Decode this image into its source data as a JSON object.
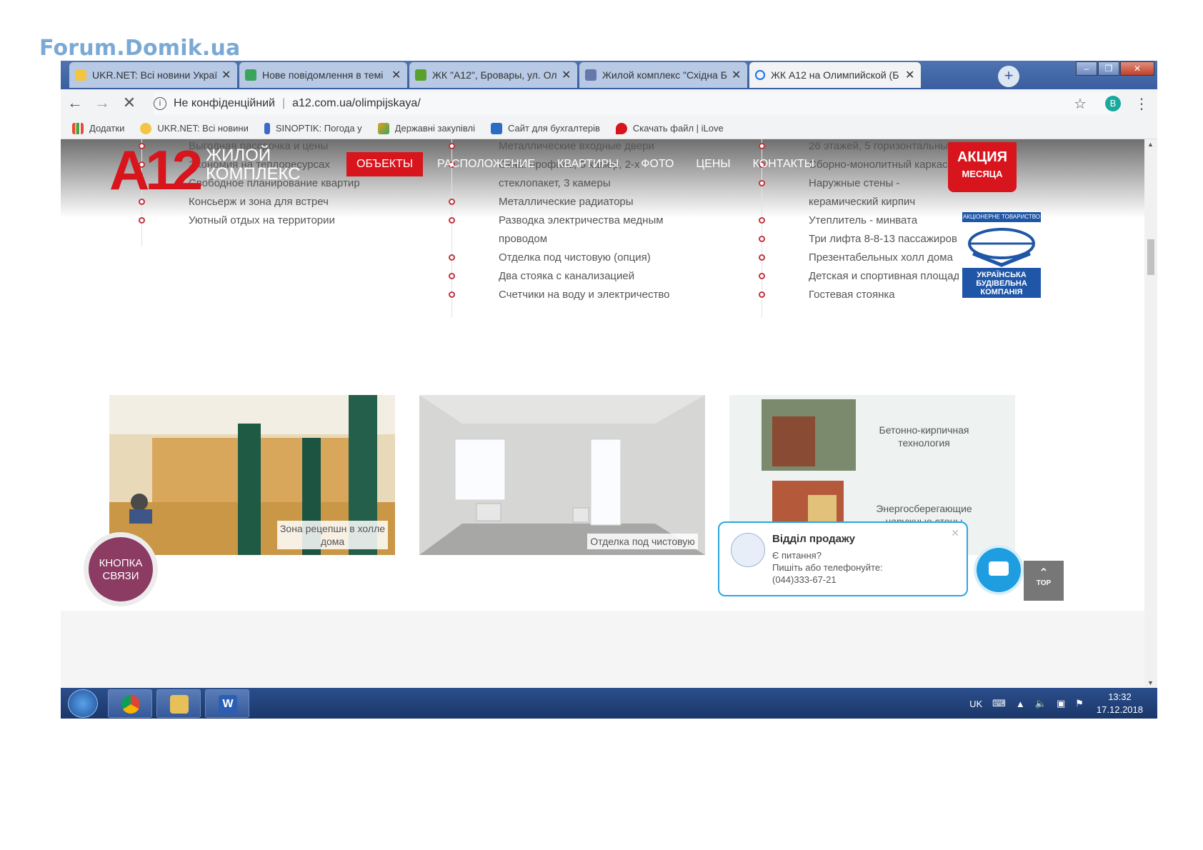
{
  "watermark": "Forum.Domik.ua",
  "browser": {
    "tabs": [
      {
        "label": "UKR.NET: Всі новини Україн",
        "icon_color": "#f4c542"
      },
      {
        "label": "Нове повідомлення в темі",
        "icon_color": "#3aa55a"
      },
      {
        "label": "ЖК \"А12\", Бровары, ул. Ол",
        "icon_color": "#5aa02c"
      },
      {
        "label": "Жилой комплекс \"Східна Бр",
        "icon_color": "#6677aa"
      },
      {
        "label": "ЖК А12 на Олимпийской (Б",
        "icon_color": "#1a73e8",
        "active": true
      }
    ],
    "new_tab": "+",
    "address": {
      "security": "Не конфіденційний",
      "url": "a12.com.ua/olimpijskaya/"
    },
    "profile_initial": "B",
    "bookmarks": [
      {
        "label": "Додатки",
        "icon_color": "#e84a3c"
      },
      {
        "label": "UKR.NET: Всі новини",
        "icon_color": "#f4c542"
      },
      {
        "label": "SINOPTIK: Погода у",
        "icon_color": "#3b6bc7"
      },
      {
        "label": "Державні закупівлі",
        "icon_color": "#e8a020"
      },
      {
        "label": "Сайт для бухгалтерів",
        "icon_color": "#2a6bc4"
      },
      {
        "label": "Скачать файл | iLove",
        "icon_color": "#d8141c"
      }
    ]
  },
  "site": {
    "logo_mark": "A12",
    "logo_text_1": "ЖИЛОЙ",
    "logo_text_2": "КОМПЛЕКС",
    "nav": [
      "ОБЪЕКТЫ",
      "РАСПОЛОЖЕНИЕ",
      "КВАРТИРЫ",
      "ФОТО",
      "ЦЕНЫ",
      "КОНТАКТЫ"
    ],
    "promo": {
      "line1": "АКЦИЯ",
      "line2": "МЕСЯЦА"
    },
    "features": {
      "col1": [
        "Выгодная рассрочка и цены",
        "Экономия на теплоресурсах",
        "Свободное планирование квартир",
        "Консьерж и зона для встреч",
        "Уютный отдых на территории"
      ],
      "col2": [
        "Металлические входные двери",
        "Окна: профиль, 5 камер, 2-х стеклопакет, 3 камеры",
        "Металлические радиаторы",
        "Разводка электричества медным проводом",
        "Отделка под чистовую (опция)",
        "Два стояка с канализацией",
        "Счетчики на воду и электричество"
      ],
      "col3": [
        "26 этажей, 5 горизонтальных",
        "Сборно-монолитный каркас",
        "Наружные стены - керамический кирпич",
        "Утеплитель - минвата",
        "Три лифта 8-8-13 пассажиров",
        "Презентабельных холл дома",
        "Детская и спортивная площадка",
        "Гостевая стоянка"
      ]
    },
    "partner": {
      "header": "АКЦІОНЕРНЕ ТОВАРИСТВО",
      "name": "УКРАЇНСЬКА БУДІВЕЛЬНА КОМПАНІЯ"
    },
    "cards": [
      {
        "caption": "Зона рецепшн в холле дома"
      },
      {
        "caption": "Отделка под чистовую"
      },
      {
        "label1": "Бетонно-кирпичная технология",
        "label2": "Энергосберегающие наружные стены"
      }
    ],
    "call_button": "КНОПКА СВЯЗИ",
    "chat": {
      "title": "Відділ продажу",
      "line1": "Є питання?",
      "line2": "Пишіть або телефонуйте:",
      "phone": "(044)333-67-21"
    },
    "top_button": "TOP"
  },
  "taskbar": {
    "lang": "UK",
    "time": "13:32",
    "date": "17.12.2018"
  }
}
